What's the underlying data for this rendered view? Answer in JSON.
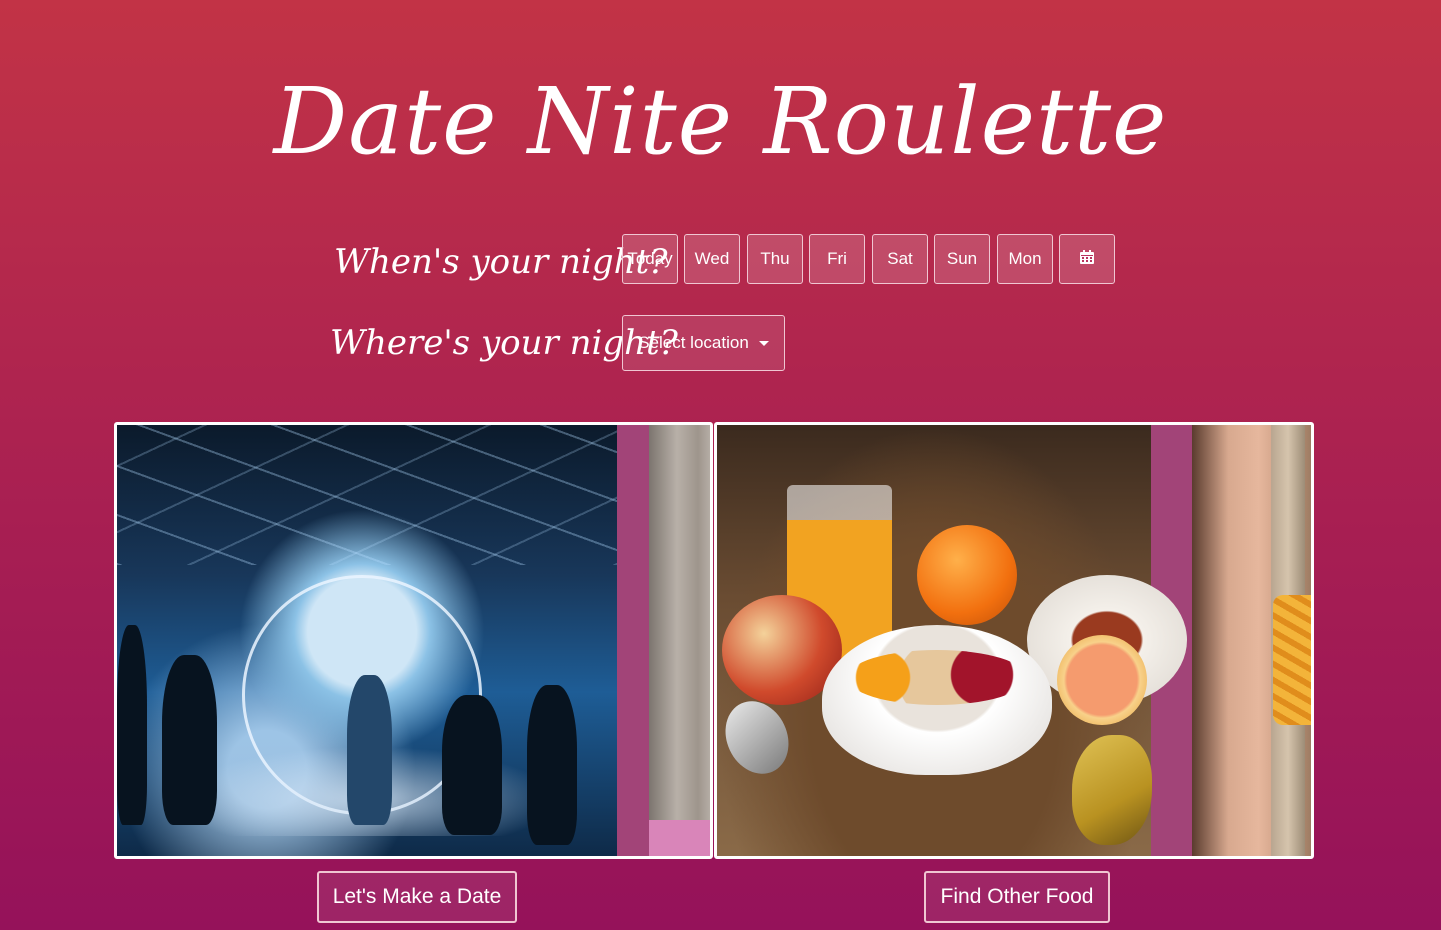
{
  "header": {
    "title": "Date Nite Roulette"
  },
  "when": {
    "label": "When's your night?",
    "days": [
      "Today",
      "Wed",
      "Thu",
      "Fri",
      "Sat",
      "Sun",
      "Mon"
    ],
    "calendar_icon": "calendar-icon"
  },
  "where": {
    "label": "Where's your night?",
    "location_button": "Select location"
  },
  "cards": {
    "left_image": "concert-photo",
    "right_image": "food-photo"
  },
  "actions": {
    "date_button": "Let's Make a Date",
    "food_button": "Find Other Food"
  }
}
